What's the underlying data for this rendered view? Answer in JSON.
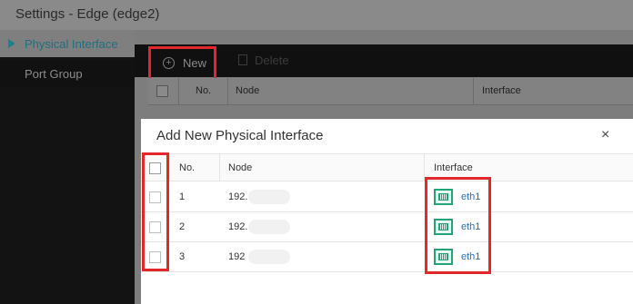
{
  "window": {
    "title": "Settings - Edge (edge2)"
  },
  "sidebar": {
    "items": [
      {
        "label": "Physical Interface",
        "active": true
      },
      {
        "label": "Port Group",
        "active": false
      }
    ]
  },
  "toolbar": {
    "new_label": "New",
    "delete_label": "Delete"
  },
  "background_table": {
    "headers": [
      "No.",
      "Node",
      "Interface"
    ]
  },
  "modal": {
    "title": "Add New Physical Interface",
    "close_label": "×",
    "headers": [
      "No.",
      "Node",
      "Interface"
    ],
    "rows": [
      {
        "no": "1",
        "node": "192.",
        "interface": "eth1"
      },
      {
        "no": "2",
        "node": "192.",
        "interface": "eth1"
      },
      {
        "no": "3",
        "node": "192",
        "interface": "eth1"
      }
    ]
  },
  "colors": {
    "highlight": "#e0282e",
    "accent": "#1f7f8e",
    "nic_icon": "#23a37a",
    "link": "#2b6fb0"
  },
  "icons": {
    "new": "plus-circle-icon",
    "delete": "trash-icon",
    "interface": "network-port-icon",
    "active_marker": "triangle-right-icon"
  }
}
